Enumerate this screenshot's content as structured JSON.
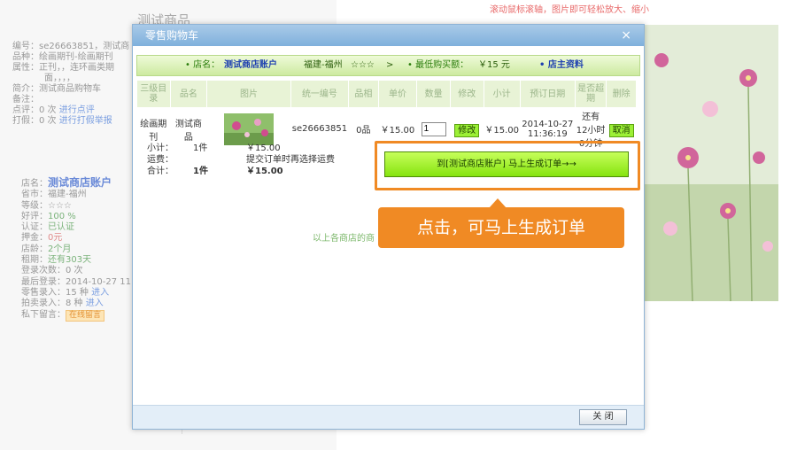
{
  "background": {
    "product_title": "测试商品",
    "info_rows": [
      {
        "label": "编号：",
        "value": "se26663851，测试商"
      },
      {
        "label": "品种：",
        "value": "绘画期刊-绘画期刊"
      },
      {
        "label": "属性：",
        "value": "正刊，，连环画类期"
      },
      {
        "label": "",
        "value": "面，，，，"
      },
      {
        "label": "简介：",
        "value": "测试商品购物车"
      },
      {
        "label": "备注：",
        "value": ""
      }
    ],
    "rate_row": {
      "label": "点评：",
      "count": "0 次",
      "link": "进行点评"
    },
    "fake_row": {
      "label": "打假：",
      "count": "0 次",
      "link": "进行打假举报"
    },
    "store": {
      "name_label": "店名：",
      "name": "测试商店账户",
      "province_label": "省市：",
      "province": "福建-福州",
      "level_label": "等级：",
      "level": "☆☆☆",
      "praise_label": "好评：",
      "praise": "100 %",
      "cert_label": "认证：",
      "cert": "已认证",
      "deposit_label": "押金：",
      "deposit": "0元",
      "age_label": "店龄：",
      "age": "2个月",
      "lease_label": "租期：",
      "lease": "还有303天",
      "logins_label": "登录次数：",
      "logins": "0 次",
      "last_login_label": "最后登录：",
      "last_login": "2014-10-27 11",
      "retail_label": "零售录入：",
      "retail": "15 种",
      "retail_link": "进入",
      "auction_label": "拍卖录入：",
      "auction": "8 种",
      "auction_link": "进入",
      "msg_label": "私下留言：",
      "msg_btn": "在线留言"
    },
    "hint": "滚动鼠标滚轴，图片即可轻松放大、缩小"
  },
  "dialog": {
    "title": "零售购物车",
    "close_symbol": "×",
    "store_bar": {
      "name_label": "• 店名：",
      "name": "测试商店账户",
      "location": "福建-福州",
      "stars": "☆☆☆",
      "arrow": ">",
      "min_label": "• 最低购买额：",
      "min_value": "￥15 元",
      "info_link": "• 店主资料"
    },
    "columns": [
      "三级目录",
      "品名",
      "图片",
      "统一编号",
      "品相",
      "单价",
      "数量",
      "修改",
      "小计",
      "预订日期",
      "是否超期",
      "删除"
    ],
    "row": {
      "category": "绘画期刊",
      "name": "测试商品",
      "code": "se26663851",
      "condition": "0品",
      "price": "￥15.00",
      "qty": "1",
      "modify_btn": "修改",
      "subtotal": "￥15.00",
      "date": "2014-10-27 11:36:19",
      "overdue": "还有 12小时0分钟",
      "delete_btn": "取消"
    },
    "summary": {
      "subtotal_label": "小计：",
      "subtotal_count": "1件",
      "subtotal_value": "￥15.00",
      "shipping_label": "运费：",
      "shipping_value": "提交订单时再选择运费",
      "total_label": "合计：",
      "total_count": "1件",
      "total_value": "￥15.00"
    },
    "order_button": "到[测试商店账户] 马上生成订单→→",
    "callout": "点击，可马上生成订单",
    "footnote": "以上各商店的商",
    "close_button": "关 闭"
  },
  "colors": {
    "accent": "#f08a24",
    "title_bar": "#8dbbe4",
    "green_btn": "#9cf036"
  }
}
